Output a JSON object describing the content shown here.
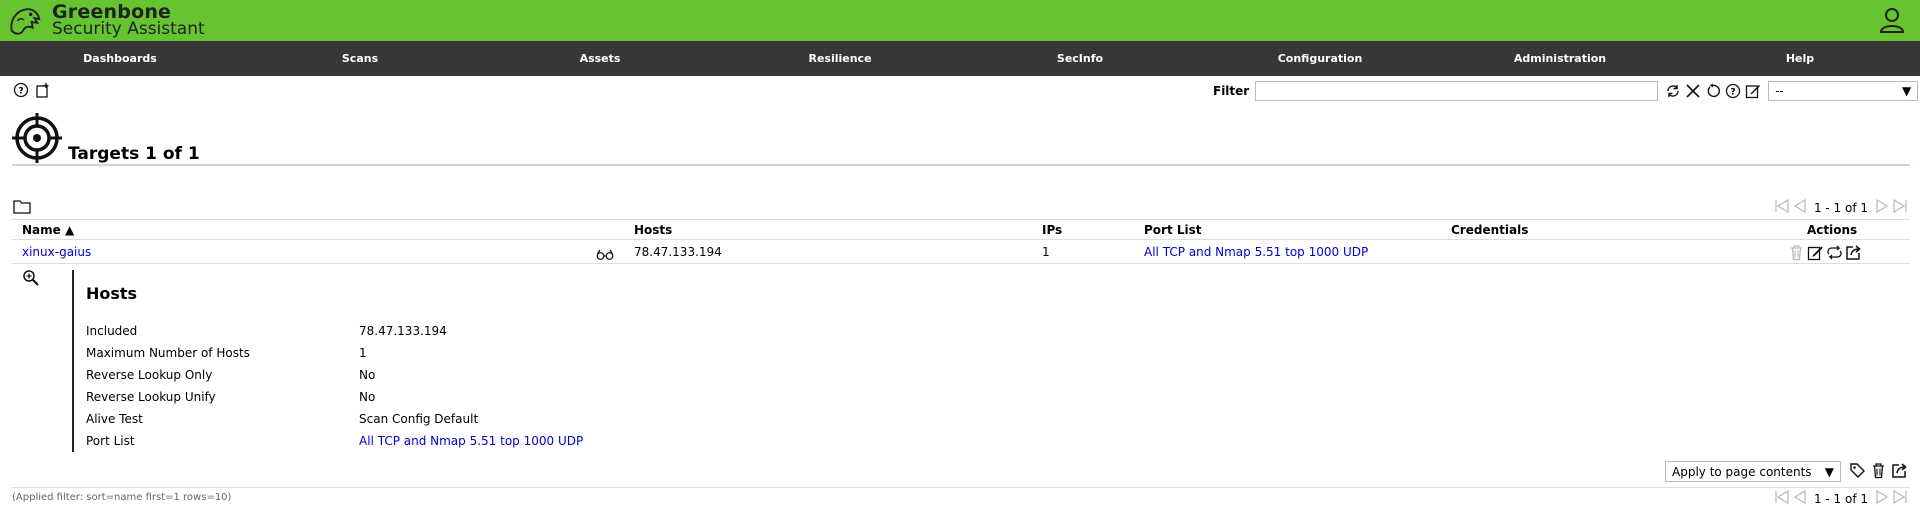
{
  "app": {
    "brand_line1": "Greenbone",
    "brand_line2": "Security Assistant",
    "accent_color": "#66c430",
    "nav_color": "#393637"
  },
  "nav": {
    "items": [
      {
        "label": "Dashboards"
      },
      {
        "label": "Scans"
      },
      {
        "label": "Assets"
      },
      {
        "label": "Resilience"
      },
      {
        "label": "SecInfo"
      },
      {
        "label": "Configuration"
      },
      {
        "label": "Administration"
      },
      {
        "label": "Help"
      }
    ]
  },
  "toolbar": {
    "icons": [
      "help-icon",
      "new-target-icon"
    ]
  },
  "filter": {
    "label": "Filter",
    "value": "",
    "select_value": "--",
    "icons": [
      "refresh-icon",
      "clear-icon",
      "reset-icon",
      "help-icon",
      "edit-icon"
    ]
  },
  "page": {
    "title": "Targets 1 of 1"
  },
  "pagination": {
    "text": "1 - 1 of 1"
  },
  "table": {
    "headers": {
      "name": "Name ▲",
      "hosts": "Hosts",
      "ips": "IPs",
      "port_list": "Port List",
      "credentials": "Credentials",
      "actions": "Actions"
    },
    "rows": [
      {
        "name": "xinux-gaius",
        "hosts": "78.47.133.194",
        "ips": "1",
        "port_list": "All TCP and Nmap 5.51 top 1000 UDP",
        "credentials": ""
      }
    ]
  },
  "details": {
    "title": "Hosts",
    "rows": [
      {
        "label": "Included",
        "value": "78.47.133.194"
      },
      {
        "label": "Maximum Number of Hosts",
        "value": "1"
      },
      {
        "label": "Reverse Lookup Only",
        "value": "No"
      },
      {
        "label": "Reverse Lookup Unify",
        "value": "No"
      },
      {
        "label": "Alive Test",
        "value": "Scan Config Default"
      },
      {
        "label": "Port List",
        "value": "All TCP and Nmap 5.51 top 1000 UDP"
      }
    ]
  },
  "bulk": {
    "select_value": "Apply to page contents"
  },
  "footer": {
    "applied_filter": "(Applied filter: sort=name first=1 rows=10)"
  }
}
